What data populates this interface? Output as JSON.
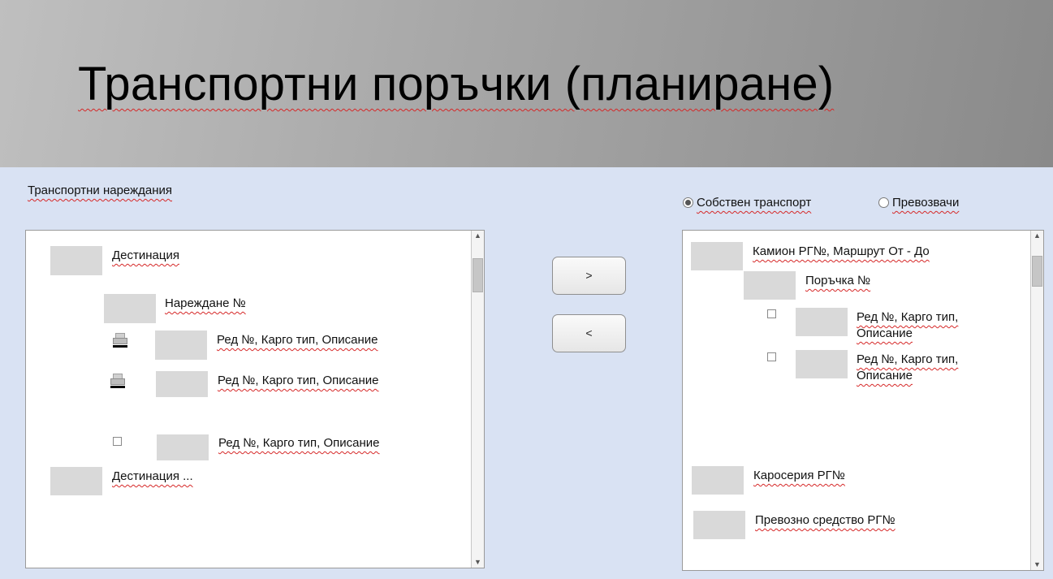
{
  "title": "Транспортни поръчки (планиране)",
  "left_panel": {
    "label": "Транспортни нареждания",
    "items": [
      "Дестинация",
      "Нареждане №",
      "Ред №, Карго тип, Описание",
      "Ред №, Карго тип, Описание",
      "Ред №, Карго тип, Описание",
      "Дестинация ..."
    ]
  },
  "buttons": {
    "move_right": ">",
    "move_left": "<"
  },
  "transport_options": {
    "own": "Собствен транспорт",
    "carriers": "Превозвачи",
    "selected": "own"
  },
  "right_panel": {
    "items": [
      "Камион РГ№, Маршрут От - До",
      "Поръчка №",
      "Ред №, Карго тип, Описание",
      "Ред №, Карго тип, Описание",
      "Каросерия РГ№",
      "Превозно средство РГ№"
    ]
  },
  "icons": {
    "tree_node": "placeholder-box",
    "item_state_1": "printer-icon",
    "item_state_2": "checkbox"
  }
}
